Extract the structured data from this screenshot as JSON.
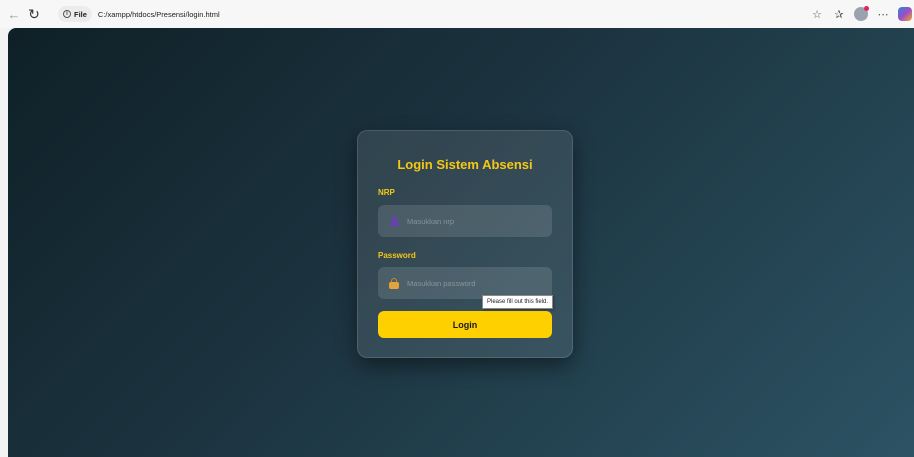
{
  "browser": {
    "site_info_label": "File",
    "url": "C:/xampp/htdocs/Presensi/login.html",
    "back_icon": "arrow-left-icon",
    "reload_icon": "reload-icon"
  },
  "login": {
    "title": "Login Sistem Absensi",
    "nrp_label": "NRP",
    "nrp_placeholder": "Masukkan nrp",
    "password_label": "Password",
    "password_placeholder": "Masukkan password",
    "button_label": "Login",
    "validation_message": "Please fill out this field."
  },
  "colors": {
    "accent": "#f5c816",
    "button": "#ffd000",
    "bg_start": "#0f2027",
    "bg_end": "#2c5364"
  }
}
